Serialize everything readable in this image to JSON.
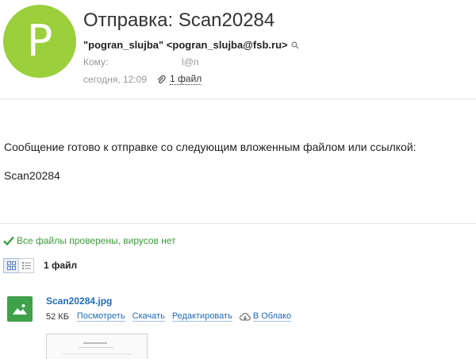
{
  "header": {
    "avatar_letter": "P",
    "avatar_color": "#9bcf3c",
    "subject": "Отправка: Scan20284",
    "from": "\"pogran_slujba\" <pogran_slujba@fsb.ru>",
    "to_label": "Кому:",
    "to_value": "l@n",
    "date": "сегодня, 12:09",
    "attachments_link": "1 файл"
  },
  "body": {
    "line1": "Сообщение готово к отправке со следующим вложенным файлом или ссылкой:",
    "line2": "Scan20284"
  },
  "attachments": {
    "antivirus_status": "Все файлы проверены, вирусов нет",
    "count_label": "1 файл",
    "files": [
      {
        "name": "Scan20284.jpg",
        "size": "52 КБ",
        "actions": {
          "view": "Посмотреть",
          "download": "Скачать",
          "edit": "Редактировать",
          "cloud": "В Облако"
        }
      }
    ]
  },
  "colors": {
    "link": "#1f6bbf",
    "status_green": "#3a9e3a",
    "file_icon": "#3fa14a"
  }
}
